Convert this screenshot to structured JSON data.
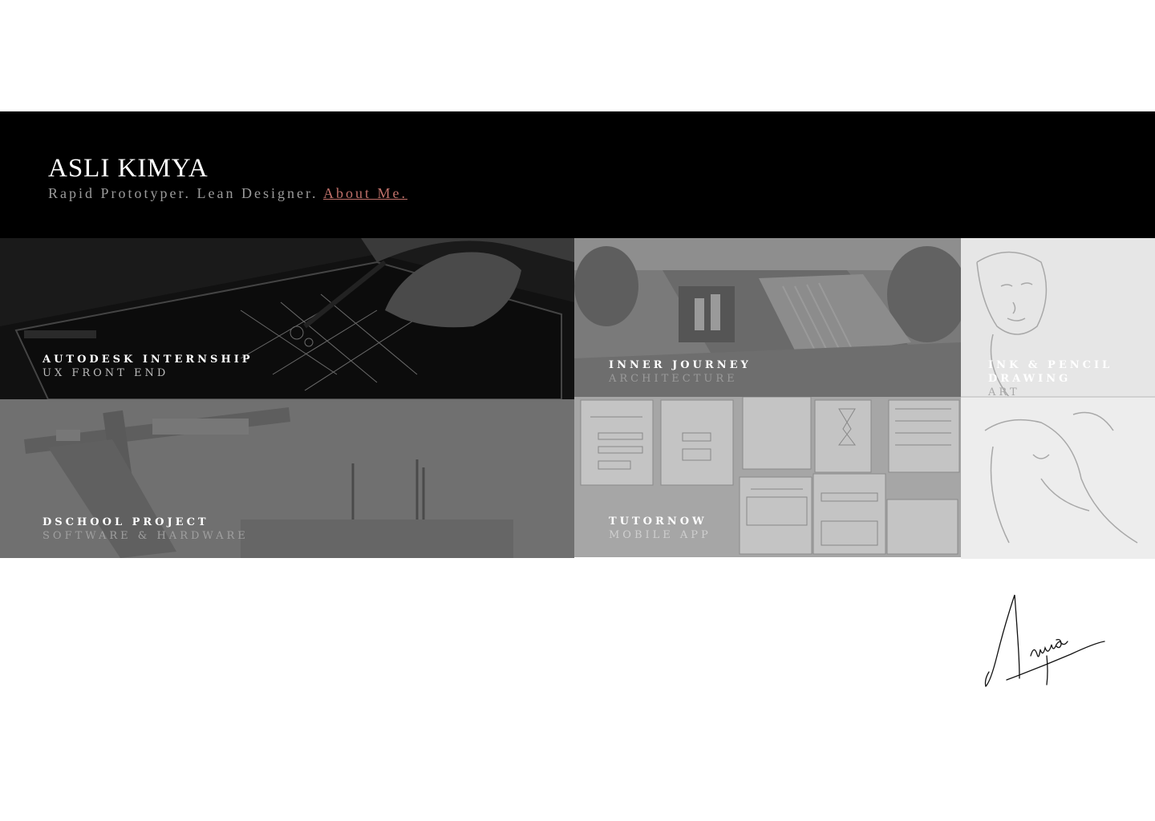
{
  "header": {
    "name": "ASLI KIMYA",
    "tagline": "Rapid Prototyper. Lean Designer. ",
    "about_link": "About Me."
  },
  "tiles": [
    {
      "title": "AUTODESK INTERNSHIP",
      "subtitle": "UX FRONT END"
    },
    {
      "title": "INNER JOURNEY",
      "subtitle": "ARCHITECTURE"
    },
    {
      "title": "INK & PENCIL DRAWING",
      "title_line1": "INK & PENCIL",
      "title_line2": "DRAWING",
      "subtitle": "ART"
    },
    {
      "title": "DSCHOOL PROJECT",
      "subtitle": "SOFTWARE & HARDWARE"
    },
    {
      "title": "TUTORNOW",
      "subtitle": "MOBILE APP"
    }
  ],
  "images": {
    "autodesk": "tablet-stylus-photo",
    "inner_journey": "architecture-model-photo",
    "ink_pencil": "pencil-sketch-drawing",
    "dschool": "woven-prototype-photo",
    "tutornow": "paper-prototype-photo"
  },
  "colors": {
    "accent": "#c0716a",
    "header_bg": "#000000"
  }
}
